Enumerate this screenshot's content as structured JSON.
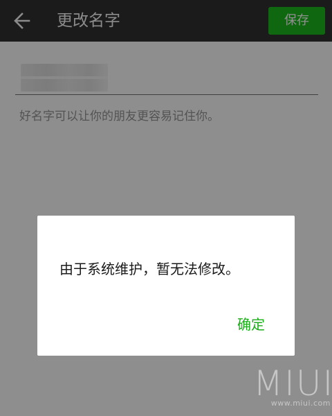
{
  "topbar": {
    "back_icon": "arrow-left-icon",
    "title": "更改名字",
    "save_label": "保存"
  },
  "form": {
    "name_value": "",
    "hint": "好名字可以让你的朋友更容易记住你。"
  },
  "dialog": {
    "message": "由于系统维护，暂无法修改。",
    "confirm_label": "确定"
  },
  "watermark": {
    "logo": "MIUI",
    "url": "www.miui.com"
  },
  "colors": {
    "accent_green": "#1aad19",
    "topbar_bg": "#2e2e2e",
    "page_bg": "#ededed"
  }
}
